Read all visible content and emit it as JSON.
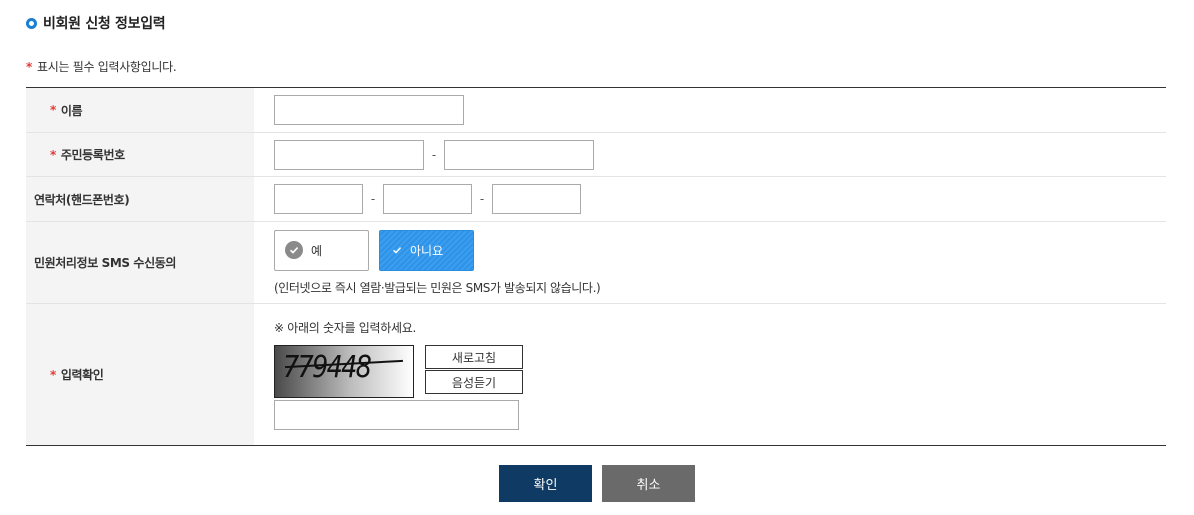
{
  "page": {
    "title": "비회원 신청 정보입력",
    "required_note": "표시는 필수 입력사항입니다.",
    "required_mark": "*"
  },
  "form": {
    "name": {
      "label": "이름",
      "required": true,
      "value": ""
    },
    "rrn": {
      "label": "주민등록번호",
      "required": true,
      "part1": "",
      "part2": "",
      "separator": "-"
    },
    "phone": {
      "label": "연락처(핸드폰번호)",
      "required": false,
      "part1": "",
      "part2": "",
      "part3": "",
      "separator": "-"
    },
    "sms": {
      "label": "민원처리정보 SMS 수신동의",
      "required": false,
      "options": [
        {
          "label": "예",
          "selected": false
        },
        {
          "label": "아니요",
          "selected": true
        }
      ],
      "note": "(인터넷으로 즉시 열람·발급되는 민원은 SMS가 발송되지 않습니다.)"
    },
    "captcha": {
      "label": "입력확인",
      "required": true,
      "note": "※ 아래의 숫자를 입력하세요.",
      "image_text": "779448",
      "refresh_label": "새로고침",
      "audio_label": "음성듣기",
      "value": ""
    }
  },
  "actions": {
    "confirm_label": "확인",
    "cancel_label": "취소"
  },
  "colors": {
    "accent": "#1a7fd1",
    "required": "#e33b3b",
    "selected": "#3a9ff0",
    "confirm": "#0e3a63",
    "cancel": "#6a6a6a"
  }
}
